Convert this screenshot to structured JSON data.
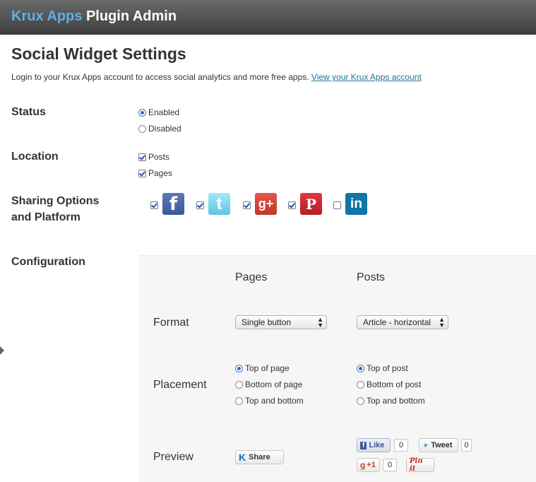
{
  "header": {
    "brand_krux": "Krux Apps",
    "brand_rest": " Plugin Admin"
  },
  "page": {
    "title": "Social Widget Settings",
    "intro_text": "Login to your Krux Apps account to access social analytics and more free apps. ",
    "intro_link": "View your Krux Apps account"
  },
  "status": {
    "label": "Status",
    "options": [
      {
        "label": "Enabled",
        "selected": true
      },
      {
        "label": "Disabled",
        "selected": false
      }
    ]
  },
  "location": {
    "label": "Location",
    "options": [
      {
        "label": "Posts",
        "checked": true
      },
      {
        "label": "Pages",
        "checked": true
      }
    ]
  },
  "sharing": {
    "label_line1": "Sharing Options",
    "label_line2": "and Platform",
    "platforms": [
      {
        "name": "facebook",
        "icon": "facebook-icon",
        "glyph": "f",
        "checked": true,
        "color": "#3b5998"
      },
      {
        "name": "twitter",
        "icon": "twitter-icon",
        "glyph": "t",
        "checked": true,
        "color": "#6fd0ee"
      },
      {
        "name": "google-plus",
        "icon": "google-plus-icon",
        "glyph": "g+",
        "checked": true,
        "color": "#d73d32"
      },
      {
        "name": "pinterest",
        "icon": "pinterest-icon",
        "glyph": "P",
        "checked": true,
        "color": "#cb2027"
      },
      {
        "name": "linkedin",
        "icon": "linkedin-icon",
        "glyph": "in",
        "checked": false,
        "color": "#0e76a8"
      }
    ]
  },
  "configuration": {
    "label": "Configuration",
    "col_pages": "Pages",
    "col_posts": "Posts",
    "format": {
      "label": "Format",
      "pages_value": "Single button",
      "posts_value": "Article - horizontal"
    },
    "placement": {
      "label": "Placement",
      "pages_options": [
        {
          "label": "Top of page",
          "selected": true
        },
        {
          "label": "Bottom of page",
          "selected": false
        },
        {
          "label": "Top and bottom",
          "selected": false
        }
      ],
      "posts_options": [
        {
          "label": "Top of post",
          "selected": true
        },
        {
          "label": "Bottom of post",
          "selected": false
        },
        {
          "label": "Top and bottom",
          "selected": false
        }
      ]
    },
    "preview": {
      "label": "Preview",
      "share_label": "Share",
      "like_label": "Like",
      "like_count": "0",
      "tweet_label": "Tweet",
      "tweet_count": "0",
      "plusone_label": "+1",
      "plusone_count": "0",
      "pinit_label": "Pin it"
    }
  },
  "colors": {
    "accent": "#5bb2e8",
    "link": "#21759b",
    "header_bg": "#4a4a4a"
  }
}
